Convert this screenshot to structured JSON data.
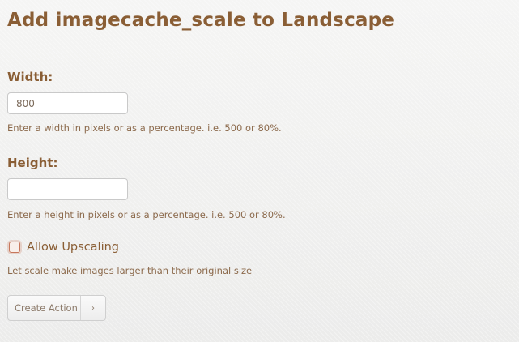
{
  "title": "Add imagecache_scale to Landscape",
  "width": {
    "label": "Width:",
    "value": "800",
    "help": "Enter a width in pixels or as a percentage. i.e. 500 or 80%."
  },
  "height": {
    "label": "Height:",
    "value": "",
    "help": "Enter a height in pixels or as a percentage. i.e. 500 or 80%."
  },
  "upscale": {
    "label": "Allow Upscaling",
    "checked": false,
    "help": "Let scale make images larger than their original size"
  },
  "submit": {
    "label": "Create Action",
    "arrow": "›"
  },
  "colors": {
    "text_brown": "#8a5e35",
    "checkbox_accent": "#c7775c"
  },
  "icons": {
    "submit_arrow": "chevron-right-icon"
  }
}
